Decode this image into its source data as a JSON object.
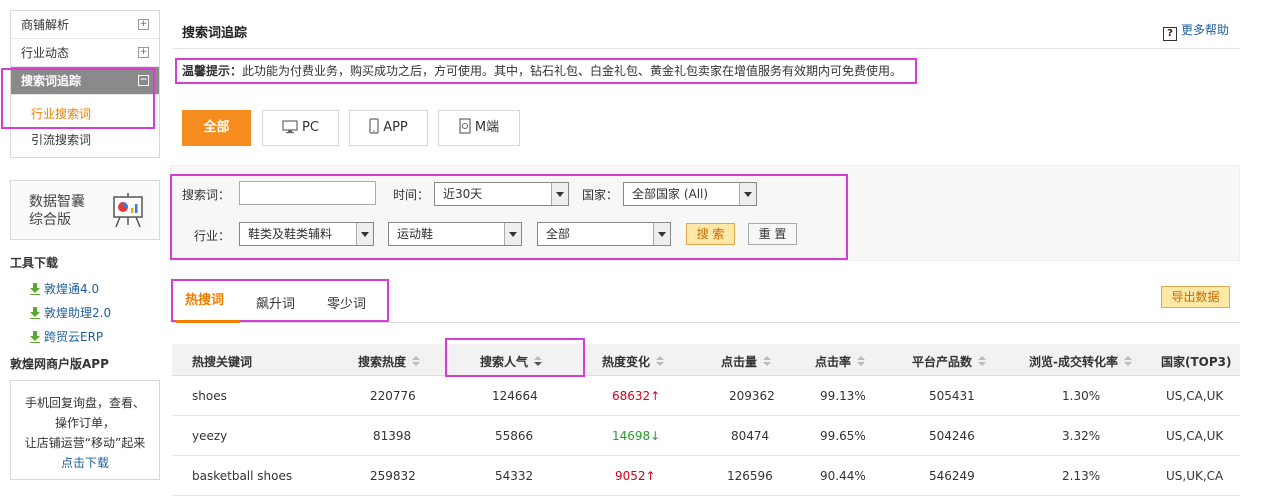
{
  "sidebar": {
    "menu": [
      {
        "label": "商铺解析",
        "toggle": "+"
      },
      {
        "label": "行业动态",
        "toggle": "+"
      },
      {
        "label": "搜索词追踪",
        "toggle": "−"
      }
    ],
    "submenu": [
      "行业搜索词",
      "引流搜索词"
    ],
    "promo_line1": "数据智囊",
    "promo_line2": "综合版",
    "tools_title": "工具下载",
    "tools": [
      "敦煌通4.0",
      "敦煌助理2.0",
      "跨贸云ERP"
    ],
    "app_title": "敦煌网商户版APP",
    "app_lines": [
      "手机回复询盘，查看、",
      "操作订单，",
      "让店铺运营“移动”起来"
    ],
    "app_link": "点击下载"
  },
  "header": {
    "title": "搜索词追踪",
    "help": "更多帮助",
    "help_icon": "?"
  },
  "notice": {
    "label": "温馨提示：",
    "text": "此功能为付费业务，购买成功之后，方可使用。其中，钻石礼包、白金礼包、黄金礼包卖家在增值服务有效期内可免费使用。"
  },
  "platform_tabs": [
    "全部",
    "PC",
    "APP",
    "M端"
  ],
  "filters": {
    "keyword_label": "搜索词：",
    "keyword_value": "",
    "time_label": "时间：",
    "time_value": "近30天",
    "country_label": "国家：",
    "country_value": "全部国家 (All)",
    "industry_label": "行业：",
    "industry_1": "鞋类及鞋类辅料",
    "industry_2": "运动鞋",
    "industry_3": "全部",
    "search_btn": "搜 索",
    "reset_btn": "重 置"
  },
  "result_tabs": [
    "热搜词",
    "飙升词",
    "零少词"
  ],
  "export_btn": "导出数据",
  "table": {
    "headers": [
      "热搜关键词",
      "搜索热度",
      "搜索人气",
      "热度变化",
      "点击量",
      "点击率",
      "平台产品数",
      "浏览-成交转化率",
      "国家(TOP3)"
    ],
    "rows": [
      {
        "keyword": "shoes",
        "heat": "220776",
        "popularity": "124664",
        "change": "68632",
        "trend": "up",
        "clicks": "209362",
        "ctr": "99.13%",
        "products": "505431",
        "conversion": "1.30%",
        "countries": "US,CA,UK"
      },
      {
        "keyword": "yeezy",
        "heat": "81398",
        "popularity": "55866",
        "change": "14698",
        "trend": "down",
        "clicks": "80474",
        "ctr": "99.65%",
        "products": "504246",
        "conversion": "3.32%",
        "countries": "US,CA,UK"
      },
      {
        "keyword": "basketball shoes",
        "heat": "259832",
        "popularity": "54332",
        "change": "9052",
        "trend": "up",
        "clicks": "126596",
        "ctr": "90.44%",
        "products": "546249",
        "conversion": "2.13%",
        "countries": "US,UK,CA"
      }
    ]
  }
}
